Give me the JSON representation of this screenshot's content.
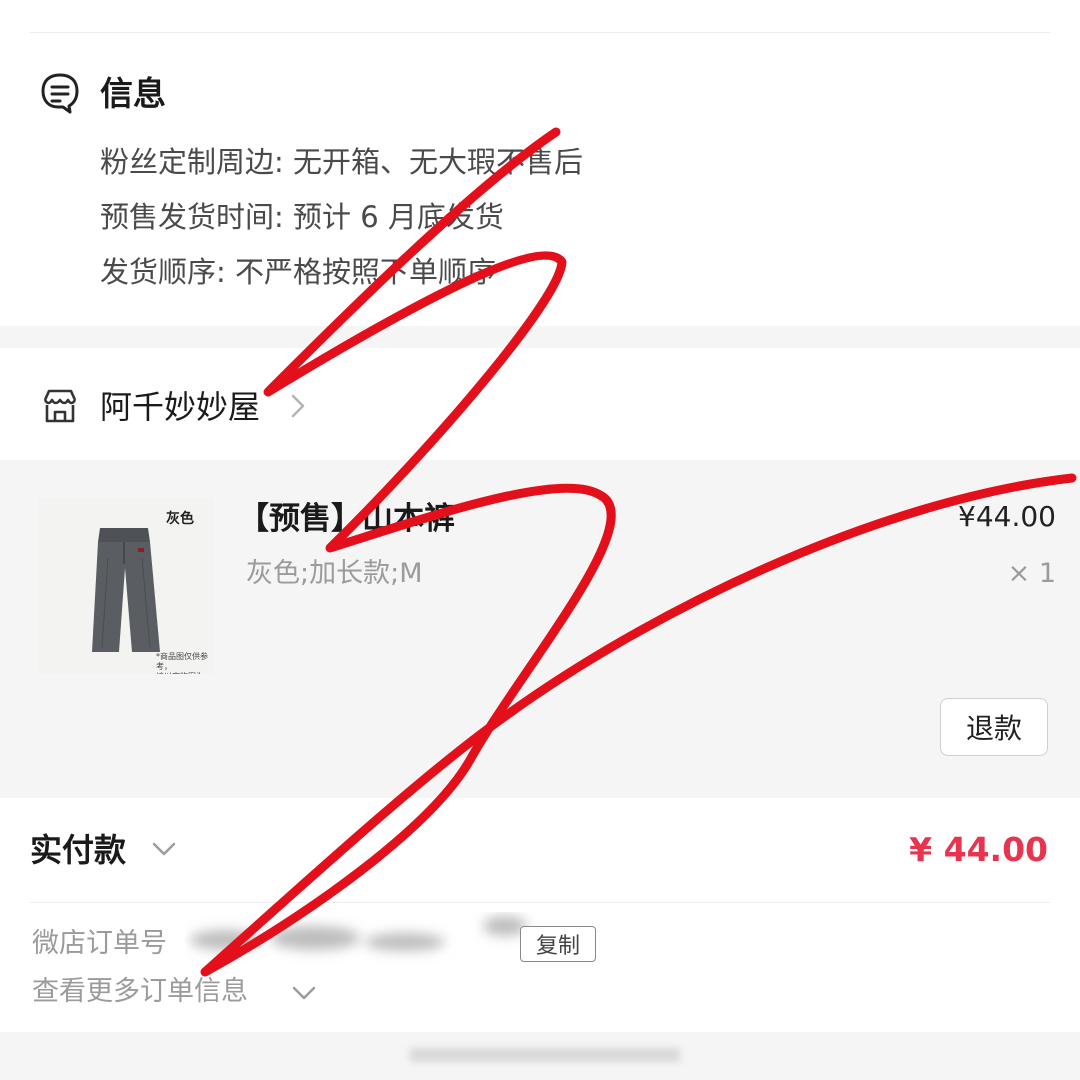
{
  "info": {
    "title": "信息",
    "lines": [
      "粉丝定制周边: 无开箱、无大瑕不售后",
      "预售发货时间: 预计 6 月底发货",
      "发货顺序: 不严格按照下单顺序"
    ]
  },
  "shop": {
    "name": "阿千妙妙屋"
  },
  "product": {
    "image_tag": "灰色",
    "image_note": "*商品图仅供参考，\n请以实物图为准。",
    "title": "【预售】山本裤",
    "sku": "灰色;加长款;M",
    "price": "¥44.00",
    "quantity": "× 1",
    "refund_label": "退款"
  },
  "payment": {
    "label": "实付款",
    "amount": "¥ 44.00",
    "amount_color": "#e8344e"
  },
  "order": {
    "number_label": "微店订单号",
    "copy_label": "复制",
    "more_label": "查看更多订单信息"
  },
  "icons": {
    "info": "document-chat-icon",
    "shop": "storefront-icon",
    "shop_arrow": "chevron-right-icon",
    "paid_toggle": "chevron-down-icon",
    "more_toggle": "chevron-down-icon"
  },
  "overlay": {
    "scribble_color": "#e3101c"
  }
}
